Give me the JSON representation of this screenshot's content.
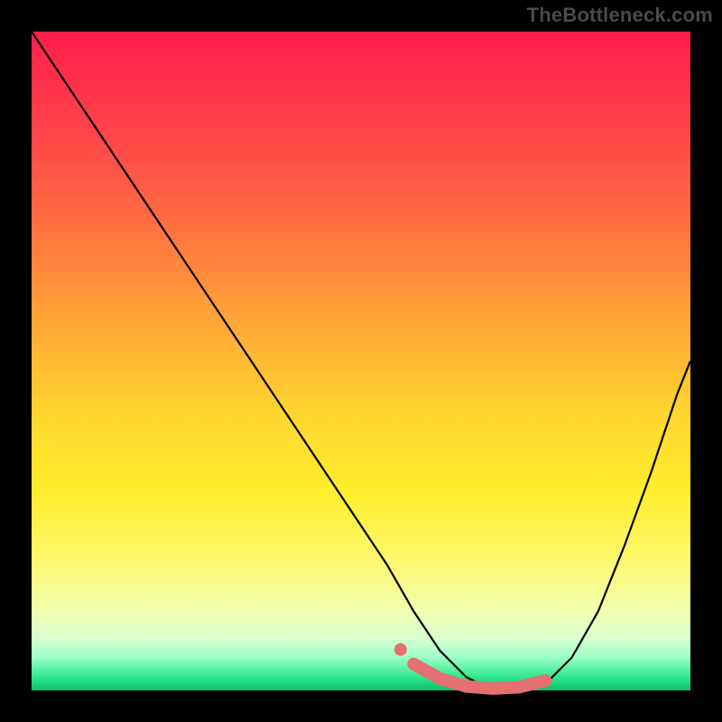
{
  "watermark": "TheBottleneck.com",
  "chart_data": {
    "type": "line",
    "title": "",
    "xlabel": "",
    "ylabel": "",
    "xlim": [
      0,
      100
    ],
    "ylim": [
      0,
      100
    ],
    "grid": false,
    "legend": false,
    "series": [
      {
        "name": "bottleneck-curve",
        "x": [
          0,
          6,
          12,
          18,
          24,
          30,
          36,
          42,
          48,
          54,
          58,
          62,
          66,
          70,
          74,
          78,
          82,
          86,
          90,
          94,
          98,
          100
        ],
        "values": [
          100,
          91,
          82,
          73,
          64,
          55,
          46,
          37,
          28,
          19,
          12,
          6,
          2,
          0,
          0,
          1,
          5,
          12,
          22,
          33,
          45,
          50
        ]
      }
    ],
    "accent_segment": {
      "name": "optimal-range",
      "x": [
        58,
        62,
        66,
        70,
        74,
        78
      ],
      "values": [
        4,
        1.8,
        0.6,
        0.3,
        0.5,
        1.5
      ]
    },
    "accent_dots": [
      {
        "x": 56,
        "y": 6.2
      },
      {
        "x": 58,
        "y": 4.0
      }
    ],
    "background_gradient": {
      "top": "#ff1e4a",
      "mid": "#ffe22e",
      "bottom": "#09c06a"
    }
  }
}
